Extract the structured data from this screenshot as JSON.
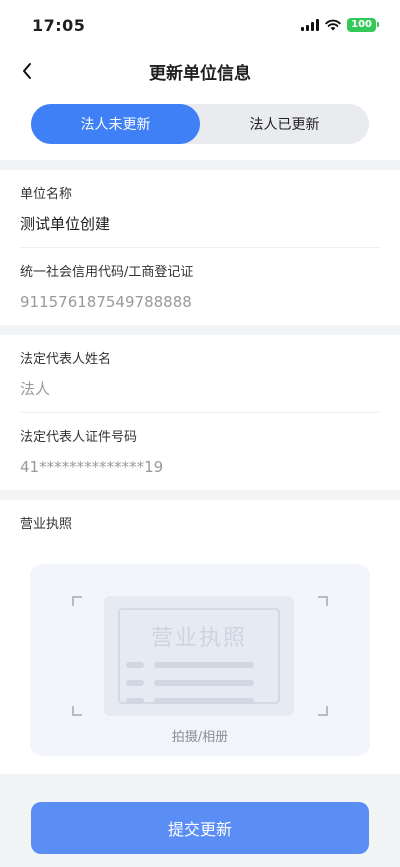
{
  "status_bar": {
    "time": "17:05",
    "battery": "100"
  },
  "nav": {
    "title": "更新单位信息"
  },
  "tabs": [
    {
      "label": "法人未更新",
      "active": true
    },
    {
      "label": "法人已更新",
      "active": false
    }
  ],
  "unit": {
    "name_label": "单位名称",
    "name_value": "测试单位创建",
    "credit_label": "统一社会信用代码/工商登记证",
    "credit_value": "911576187549788888"
  },
  "legal": {
    "name_label": "法定代表人姓名",
    "name_value": "法人",
    "id_label": "法定代表人证件号码",
    "id_value": "41**************19"
  },
  "license": {
    "label": "营业执照",
    "placeholder_title": "营业执照",
    "caption": "拍摄/相册"
  },
  "submit": {
    "label": "提交更新"
  },
  "colors": {
    "accent": "#3f80f6",
    "button": "#5b8ef5",
    "battery": "#34c759"
  }
}
